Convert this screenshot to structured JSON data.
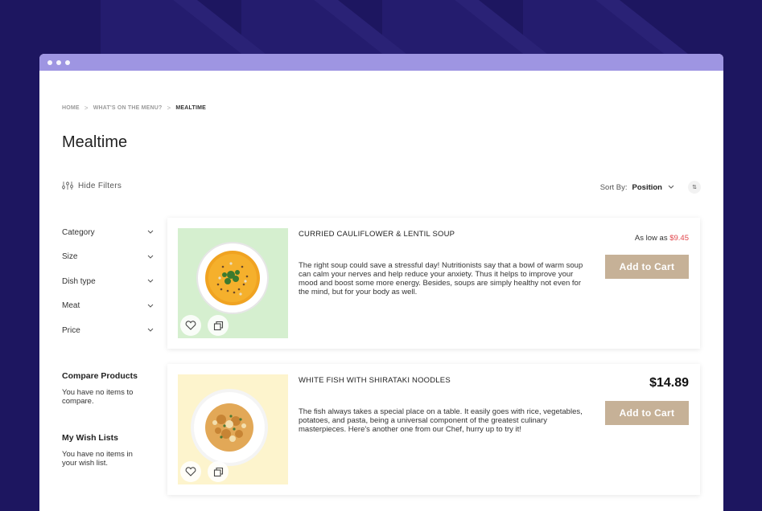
{
  "breadcrumb": {
    "home": "HOME",
    "sep": ">",
    "menu": "WHAT'S ON THE MENU?",
    "current": "MEALTIME"
  },
  "page_title": "Mealtime",
  "filters_toggle": "Hide Filters",
  "sort": {
    "label": "Sort By:",
    "value": "Position",
    "direction_glyph": "⇅"
  },
  "filters": [
    {
      "label": "Category"
    },
    {
      "label": "Size"
    },
    {
      "label": "Dish type"
    },
    {
      "label": "Meat"
    },
    {
      "label": "Price"
    }
  ],
  "compare": {
    "title": "Compare Products",
    "text": "You have no items to compare."
  },
  "wishlist": {
    "title": "My Wish Lists",
    "text": "You have no items in your wish list."
  },
  "products": [
    {
      "name": "CURRIED CAULIFLOWER & LENTIL SOUP",
      "description": "The right soup could save a stressful day! Nutritionists say that a bowl of warm soup can calm your nerves and help reduce your anxiety. Thus it helps to improve your mood and boost some more energy. Besides, soups are simply healthy not even for the mind, but for your body as well.",
      "price_prefix": "As low as",
      "price": "$9.45",
      "button": "Add to Cart",
      "image_bg": "#d5efcf"
    },
    {
      "name": "WHITE FISH WITH SHIRATAKI NOODLES",
      "description": "The fish always takes a special place on a table. It easily goes with rice, vegetables, potatoes, and pasta, being a universal component of the greatest culinary masterpieces. Here's another one from our Chef, hurry up to try it!",
      "price": "$14.89",
      "button": "Add to Cart",
      "image_bg": "#fdf4cd"
    }
  ],
  "colors": {
    "background": "#1d1660",
    "titlebar": "#9e95e2",
    "button": "#c6b197",
    "sale_price": "#e2454b"
  },
  "icons": {
    "filters": "sliders-icon",
    "wishlist": "heart-icon",
    "compare": "compare-icon",
    "chevron": "chevron-down-icon"
  }
}
